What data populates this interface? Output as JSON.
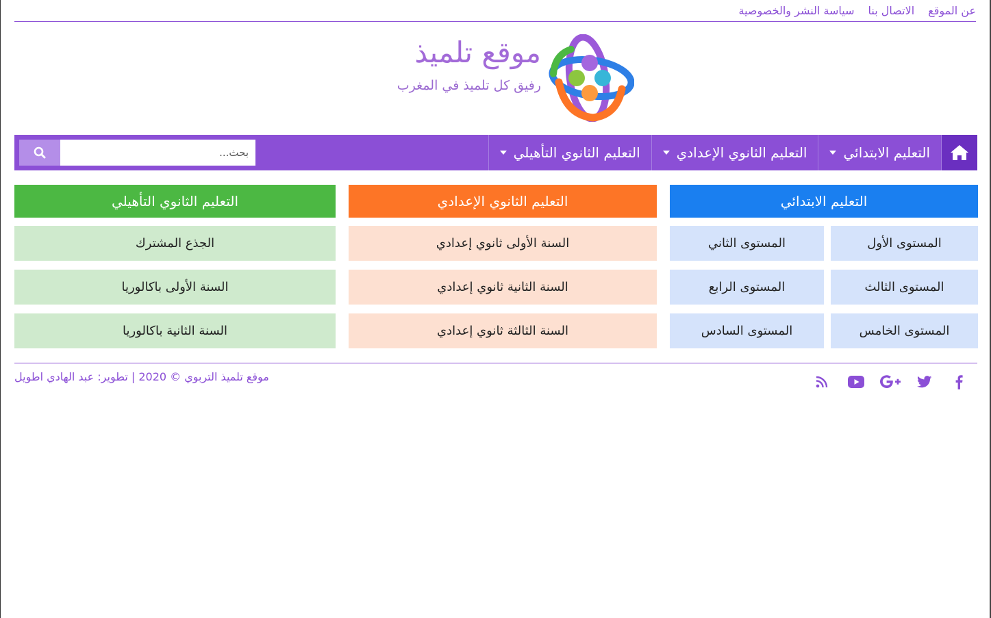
{
  "top_links": [
    "عن الموقع",
    "الاتصال بنا",
    "سياسة النشر والخصوصية"
  ],
  "logo": {
    "title": "موقع تلميذ",
    "subtitle": "رفيق كل تلميذ في المغرب"
  },
  "nav": {
    "items": [
      "التعليم الابتدائي",
      "التعليم الثانوي الإعدادي",
      "التعليم الثانوي التأهيلي"
    ],
    "search_placeholder": "بحث..."
  },
  "sections": {
    "primary": {
      "title": "التعليم الابتدائي",
      "color": "#1a7ff0",
      "cell_color": "#d5e3fb",
      "items": [
        "المستوى الأول",
        "المستوى الثاني",
        "المستوى الثالث",
        "المستوى الرابع",
        "المستوى الخامس",
        "المستوى السادس"
      ]
    },
    "middle": {
      "title": "التعليم الثانوي الإعدادي",
      "color": "#fd7526",
      "cell_color": "#fde0d1",
      "items": [
        "السنة الأولى ثانوي إعدادي",
        "السنة الثانية ثانوي إعدادي",
        "السنة الثالثة ثانوي إعدادي"
      ]
    },
    "secondary": {
      "title": "التعليم الثانوي التأهيلي",
      "color": "#4cb843",
      "cell_color": "#cfeacd",
      "items": [
        "الجذع المشترك",
        "السنة الأولى باكالوريا",
        "السنة الثانية باكالوريا"
      ]
    }
  },
  "footer": {
    "copyright": "موقع تلميذ التربوي © 2020 | تطوير: عبد الهادي اطويل",
    "social_icons": [
      "facebook-icon",
      "twitter-icon",
      "google-plus-icon",
      "youtube-icon",
      "rss-icon"
    ]
  },
  "colors": {
    "accent": "#8b4fd6",
    "accent_dark": "#6a2fc0"
  }
}
